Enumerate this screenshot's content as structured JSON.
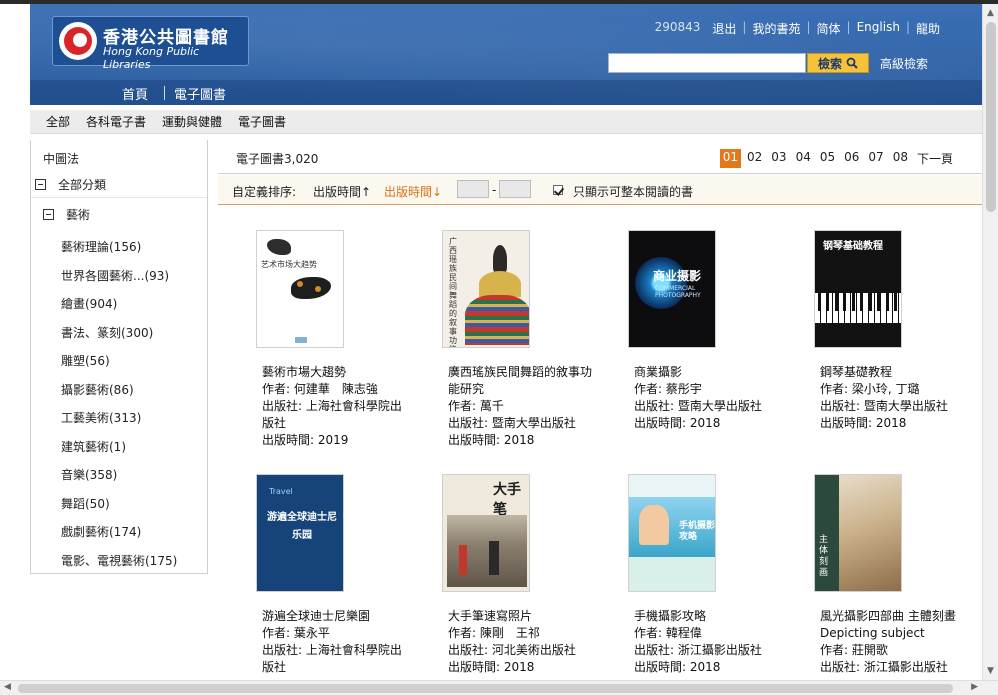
{
  "header": {
    "logo_zh": "香港公共圖書館",
    "logo_en": "Hong Kong Public Libraries",
    "account_number": "290843",
    "links": [
      "退出",
      "我的書苑",
      "简体",
      "English",
      "龍助"
    ],
    "search_button": "檢索",
    "advanced_search": "高級檢索",
    "nav": [
      "首頁",
      "電子圖書"
    ]
  },
  "subnav": [
    "全部",
    "各科電子書",
    "運動與健體",
    "電子圖書"
  ],
  "sidebar": {
    "title": "中圖法",
    "all_categories": "全部分類",
    "art": "藝術",
    "categories": [
      "藝術理論(156)",
      "世界各國藝術...(93)",
      "繪畫(904)",
      "書法、篆刻(300)",
      "雕塑(56)",
      "攝影藝術(86)",
      "工藝美術(313)",
      "建筑藝術(1)",
      "音樂(358)",
      "舞蹈(50)",
      "戲劇藝術(174)",
      "電影、電視藝術(175)"
    ]
  },
  "main": {
    "count_label": "電子圖書3,020",
    "pages": [
      "01",
      "02",
      "03",
      "04",
      "05",
      "06",
      "07",
      "08"
    ],
    "next_page": "下一頁",
    "sort_label": "自定義排序:",
    "sort_asc": "出版時間↑",
    "sort_desc": "出版時間↓",
    "range_dash": "-",
    "full_read_only": "只顯示可整本閱讀的書"
  },
  "books": [
    {
      "title": "藝術市場大趨勢",
      "author": "作者: 何建華　陳志強",
      "publisher": "出版社: 上海社會科學院出版社",
      "date": "出版時間: 2019",
      "cover_text": "艺术市场大趋势"
    },
    {
      "title": "廣西瑤族民間舞蹈的敘事功能研究",
      "author": "作者: 萬千",
      "publisher": "出版社: 暨南大學出版社",
      "date": "出版時間: 2018",
      "cover_text": "广西瑶族民间舞蹈的叙事功能研究"
    },
    {
      "title": "商業攝影",
      "author": "作者: 蔡彤宇",
      "publisher": "出版社: 暨南大學出版社",
      "date": "出版時間: 2018",
      "cover_text": "商业摄影"
    },
    {
      "title": "鋼琴基礎教程",
      "author": "作者: 梁小玲, 丁璐",
      "publisher": "出版社: 暨南大學出版社",
      "date": "出版時間: 2018",
      "cover_text": "钢琴基础教程"
    },
    {
      "title": "游遍全球迪士尼樂園",
      "author": "作者: 葉永平",
      "publisher": "出版社: 上海社會科學院出版社",
      "date": "",
      "cover_text": "游遍全球迪士尼乐园"
    },
    {
      "title": "大手筆速寫照片",
      "author": "作者: 陳剛　王祁",
      "publisher": "出版社: 河北美術出版社",
      "date": "出版時間: 2018",
      "cover_text": "大手笔"
    },
    {
      "title": "手機攝影攻略",
      "author": "作者: 韓程偉",
      "publisher": "出版社: 浙江攝影出版社",
      "date": "出版時間: 2018",
      "cover_text": "手机摄影攻略"
    },
    {
      "title": "風光攝影四部曲 主體刻畫 Depicting subject",
      "author": "作者: 莊開歌",
      "publisher": "出版社: 浙江攝影出版社",
      "date": "",
      "cover_text": "主体刻画"
    }
  ]
}
